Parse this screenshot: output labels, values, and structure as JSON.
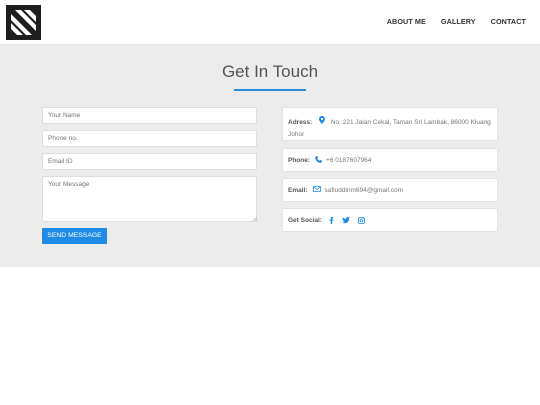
{
  "nav": {
    "logo": "logo-icon",
    "links": [
      "ABOUT ME",
      "GALLERY",
      "CONTACT"
    ]
  },
  "contact": {
    "title": "Get In Touch",
    "form": {
      "name_placeholder": "Your Name",
      "phone_placeholder": "Phone no.",
      "email_placeholder": "Email ID",
      "message_placeholder": "Your Message",
      "send_label": "SEND MESSAGE"
    },
    "info": {
      "address_label": "Adress:",
      "address_value": "No. 221 Jalan Cekal, Taman Sri Lambak, 86000 Kluang Johor",
      "phone_label": "Phone:",
      "phone_value": "+6 0187607964",
      "email_label": "Email:",
      "email_value": "safiuddinm694@gmail.com",
      "social_label": "Get Social:",
      "social_icons": [
        "facebook-icon",
        "twitter-icon",
        "instagram-icon"
      ]
    }
  },
  "colors": {
    "accent": "#1e8ce6",
    "section_bg": "#ececec",
    "logo_bg": "#1e1e1e"
  }
}
